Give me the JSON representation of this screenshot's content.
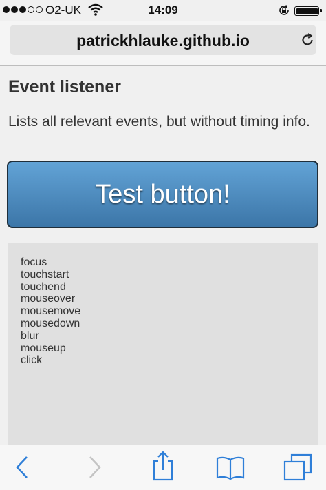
{
  "status_bar": {
    "carrier": "O2-UK",
    "time": "14:09",
    "signal_bars_filled": 3,
    "signal_bars_total": 5,
    "battery_level": 1.0
  },
  "browser": {
    "url": "patrickhlauke.github.io",
    "icons": [
      "wifi-icon",
      "rotation-lock-icon",
      "battery-icon",
      "reload-icon",
      "back-icon",
      "forward-icon",
      "share-icon",
      "bookmarks-icon",
      "tabs-icon"
    ]
  },
  "page": {
    "title": "Event listener",
    "description": "Lists all relevant events, but without timing info.",
    "button_label": "Test button!",
    "events": [
      "focus",
      "touchstart",
      "touchend",
      "mouseover",
      "mousemove",
      "mousedown",
      "blur",
      "mouseup",
      "click"
    ]
  },
  "colors": {
    "button_top": "#62a3d6",
    "button_bottom": "#3c76a8",
    "toolbar_active": "#2f7fd8",
    "toolbar_disabled": "#c4c4c4"
  }
}
